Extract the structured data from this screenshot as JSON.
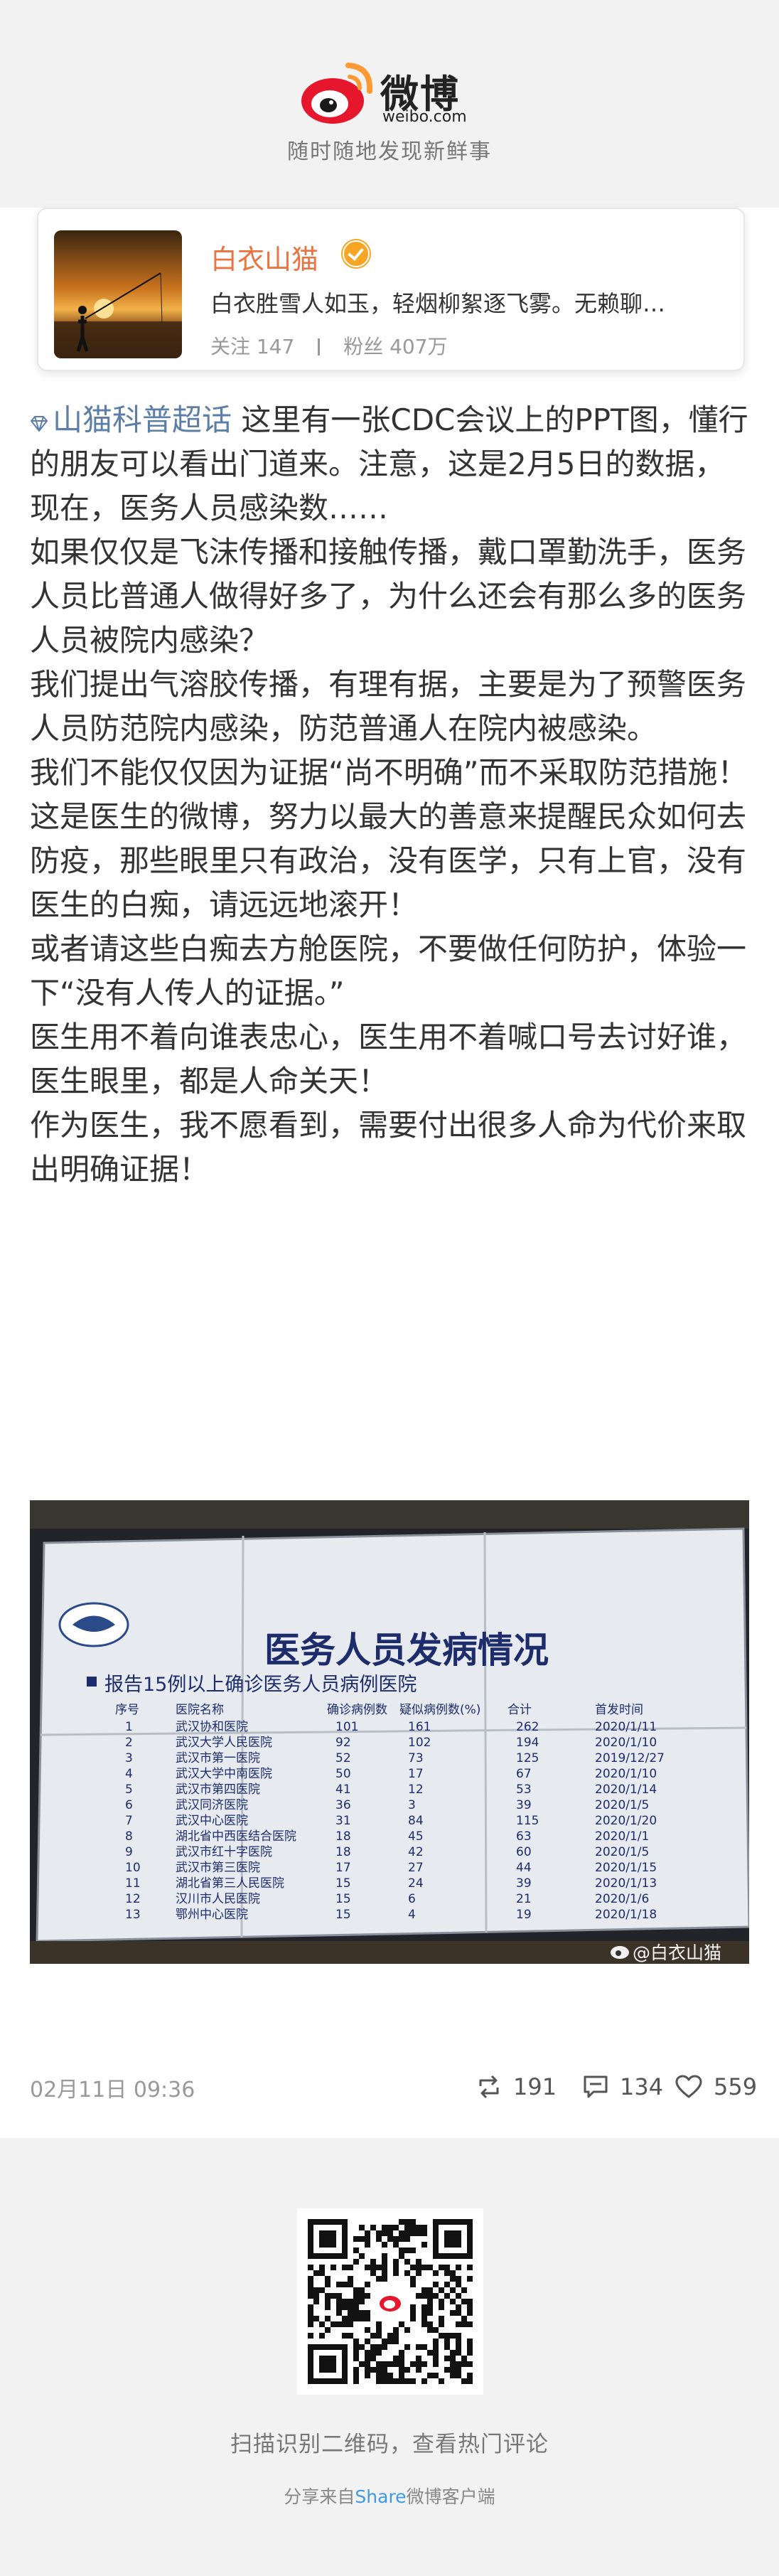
{
  "header": {
    "logo_text": "微博",
    "logo_url": "weibo.com",
    "tagline": "随时随地发现新鲜事"
  },
  "profile": {
    "name": "白衣山猫",
    "verified": true,
    "bio": "白衣胜雪人如玉，轻烟柳絮逐飞雾。无赖聊…",
    "follow_label": "关注",
    "follow_count": "147",
    "fans_label": "粉丝",
    "fans_count": "407万"
  },
  "post": {
    "topic": "山猫科普超话",
    "paragraphs": [
      "这里有一张CDC会议上的PPT图，懂行的朋友可以看出门道来。注意，这是2月5日的数据，现在，医务人员感染数……",
      "如果仅仅是飞沫传播和接触传播，戴口罩勤洗手，医务人员比普通人做得好多了，为什么还会有那么多的医务人员被院内感染？",
      "我们提出气溶胶传播，有理有据，主要是为了预警医务人员防范院内感染，防范普通人在院内被感染。",
      "我们不能仅仅因为证据“尚不明确”而不采取防范措施！",
      "这是医生的微博，努力以最大的善意来提醒民众如何去防疫，那些眼里只有政治，没有医学，只有上官，没有医生的白痴，请远远地滚开！",
      "或者请这些白痴去方舱医院，不要做任何防护，体验一下“没有人传人的证据。”",
      "医生用不着向谁表忠心，医生用不着喊口号去讨好谁，医生眼里，都是人命关天！",
      "作为医生，我不愿看到，需要付出很多人命为代价来取出明确证据！"
    ],
    "image": {
      "slide_title": "医务人员发病情况",
      "subtitle": "报告15例以上确诊医务人员病例医院",
      "columns": [
        "序号",
        "医院名称",
        "确诊病例数",
        "疑似病例数(%)",
        "合计",
        "首发时间"
      ],
      "rows": [
        [
          "1",
          "武汉协和医院",
          "101",
          "161",
          "262",
          "2020/1/11"
        ],
        [
          "2",
          "武汉大学人民医院",
          "92",
          "102",
          "194",
          "2020/1/10"
        ],
        [
          "3",
          "武汉市第一医院",
          "52",
          "73",
          "125",
          "2019/12/27"
        ],
        [
          "4",
          "武汉大学中南医院",
          "50",
          "17",
          "67",
          "2020/1/10"
        ],
        [
          "5",
          "武汉市第四医院",
          "41",
          "12",
          "53",
          "2020/1/14"
        ],
        [
          "6",
          "武汉同济医院",
          "36",
          "3",
          "39",
          "2020/1/5"
        ],
        [
          "7",
          "武汉中心医院",
          "31",
          "84",
          "115",
          "2020/1/20"
        ],
        [
          "8",
          "湖北省中西医结合医院",
          "18",
          "45",
          "63",
          "2020/1/1"
        ],
        [
          "9",
          "武汉市红十字医院",
          "18",
          "42",
          "60",
          "2020/1/5"
        ],
        [
          "10",
          "武汉市第三医院",
          "17",
          "27",
          "44",
          "2020/1/15"
        ],
        [
          "11",
          "湖北省第三人民医院",
          "15",
          "24",
          "39",
          "2020/1/13"
        ],
        [
          "12",
          "汉川市人民医院",
          "15",
          "6",
          "21",
          "2020/1/6"
        ],
        [
          "13",
          "鄂州中心医院",
          "15",
          "4",
          "19",
          "2020/1/18"
        ]
      ],
      "watermark": "@白衣山猫"
    },
    "time": "02月11日 09:36",
    "reposts": "191",
    "comments": "134",
    "likes": "559"
  },
  "footer": {
    "qr_hint": "扫描识别二维码，查看热门评论",
    "share_prefix": "分享来自",
    "share_brand": "Share",
    "share_suffix": "微博客户端"
  },
  "colors": {
    "page_bg": "#f2f2f2",
    "card_bg": "#ffffff",
    "username": "#eb7340",
    "topic": "#5d7ea6",
    "weibo_red": "#e6162d",
    "weibo_orange": "#ff9933"
  },
  "icons": [
    "weibo-logo-icon",
    "verified-badge-icon",
    "diamond-icon",
    "repost-icon",
    "comment-icon",
    "like-icon",
    "qr-code-icon"
  ]
}
